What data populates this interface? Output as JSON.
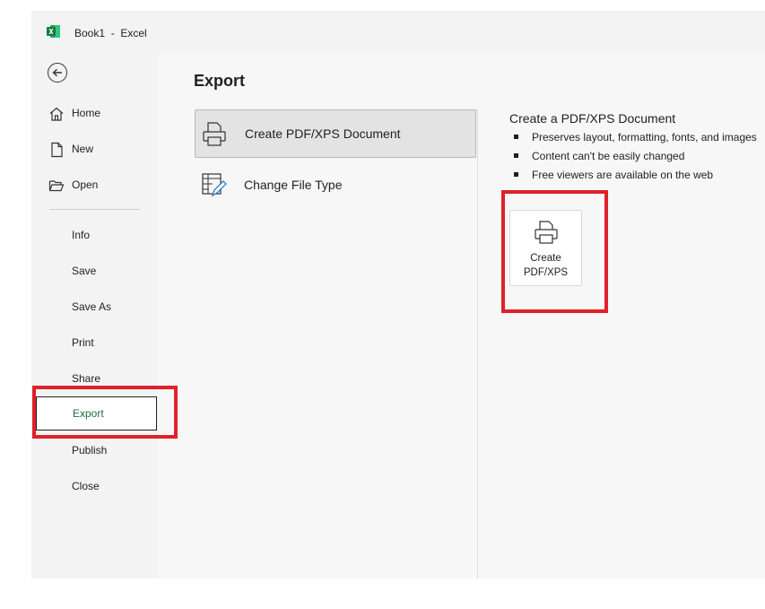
{
  "window": {
    "title": "Book1  -  Excel",
    "app_icon": "excel-icon",
    "accent_color": "#1e6f3f"
  },
  "nav": {
    "back_icon": "back-arrow-icon",
    "items_top": [
      {
        "label": "Home",
        "icon": "home-icon"
      },
      {
        "label": "New",
        "icon": "new-document-icon"
      },
      {
        "label": "Open",
        "icon": "folder-open-icon"
      }
    ],
    "items_bottom": [
      {
        "label": "Info"
      },
      {
        "label": "Save"
      },
      {
        "label": "Save As"
      },
      {
        "label": "Print"
      },
      {
        "label": "Share"
      },
      {
        "label": "Export",
        "selected": true
      },
      {
        "label": "Publish"
      },
      {
        "label": "Close"
      }
    ]
  },
  "main": {
    "title": "Export",
    "options": [
      {
        "label": "Create PDF/XPS Document",
        "icon": "pdf-document-icon",
        "selected": true
      },
      {
        "label": "Change File Type",
        "icon": "change-file-type-icon",
        "selected": false
      }
    ],
    "detail": {
      "title": "Create a PDF/XPS Document",
      "bullets": [
        "Preserves layout, formatting, fonts, and images",
        "Content can't be easily changed",
        "Free viewers are available on the web"
      ],
      "button_label": "Create\nPDF/XPS",
      "button_icon": "pdf-document-icon"
    }
  },
  "annotations": {
    "highlight_color": "#e0202a"
  }
}
